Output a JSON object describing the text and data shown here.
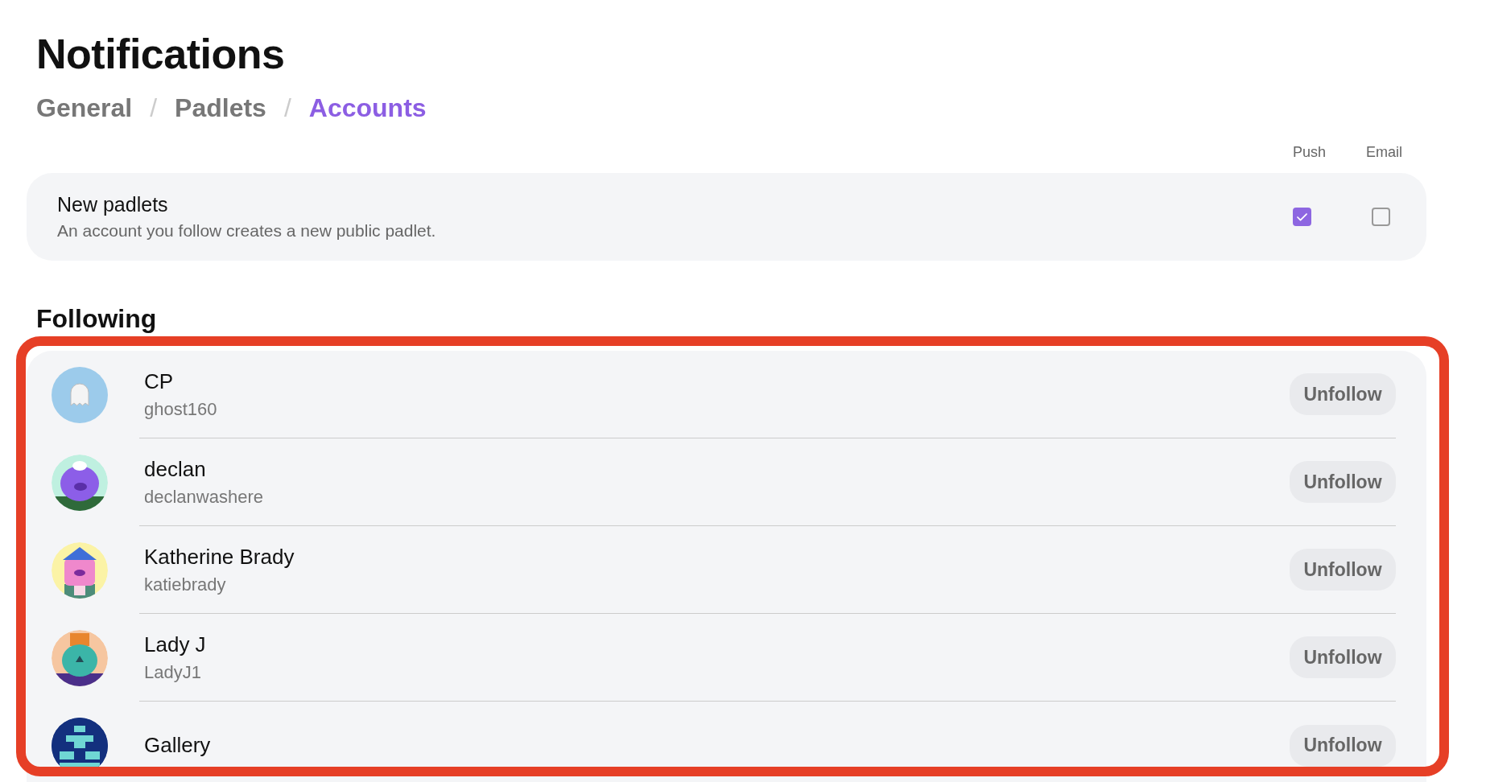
{
  "page": {
    "title": "Notifications"
  },
  "tabs": [
    {
      "label": "General",
      "selected": false
    },
    {
      "label": "Padlets",
      "selected": false
    },
    {
      "label": "Accounts",
      "selected": true
    }
  ],
  "tab_separator": "/",
  "channel_headers": [
    "Push",
    "Email"
  ],
  "settings": [
    {
      "title": "New padlets",
      "description": "An account you follow creates a new public padlet.",
      "push": {
        "checked": true
      },
      "email": {
        "checked": false
      }
    }
  ],
  "following": {
    "title": "Following",
    "accounts": [
      {
        "name": "CP",
        "handle": "ghost160",
        "avatar": {
          "kind": "ghost",
          "color": "#9ccbeb"
        },
        "button": "Unfollow"
      },
      {
        "name": "declan",
        "handle": "declanwashere",
        "button": "Unfollow"
      },
      {
        "name": "Katherine Brady",
        "handle": "katiebrady",
        "button": "Unfollow"
      },
      {
        "name": "Lady J",
        "handle": "LadyJ1",
        "button": "Unfollow"
      },
      {
        "name": "Gallery",
        "button": "Unfollow"
      }
    ]
  },
  "highlight": {
    "on": true
  }
}
